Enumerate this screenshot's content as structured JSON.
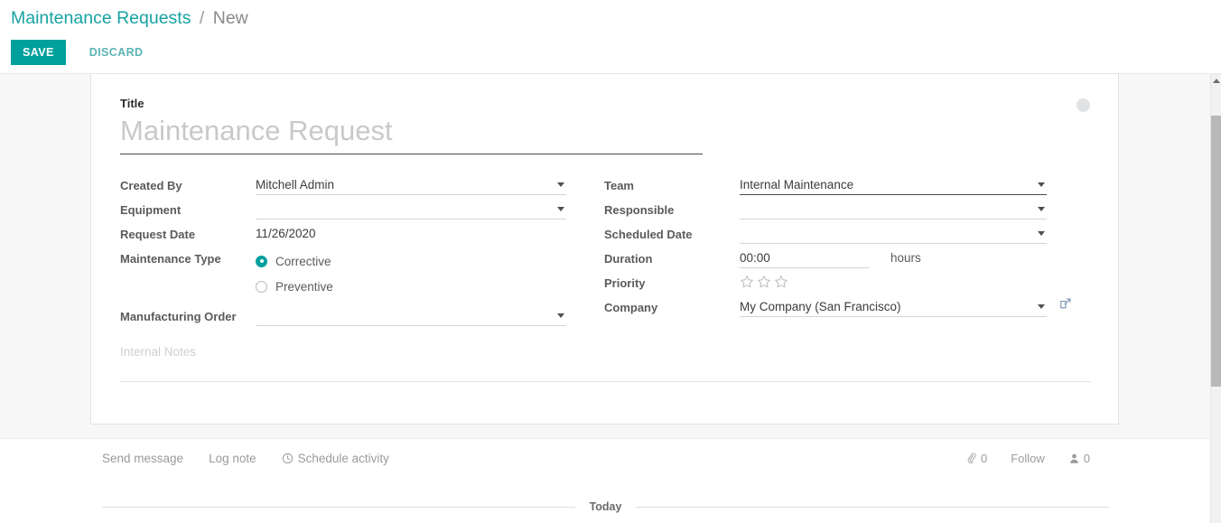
{
  "breadcrumb": {
    "root": "Maintenance Requests",
    "separator": "/",
    "current": "New"
  },
  "actions": {
    "save_label": "SAVE",
    "discard_label": "DISCARD",
    "save_color": "#00a09d",
    "discard_color": "#5bb4b4"
  },
  "form": {
    "title_label": "Title",
    "title_value": "",
    "title_placeholder": "Maintenance Request",
    "left_fields": [
      {
        "label": "Created By",
        "value": "Mitchell Admin",
        "type": "many2one"
      },
      {
        "label": "Equipment",
        "value": "",
        "type": "many2one"
      },
      {
        "label": "Request Date",
        "value": "11/26/2020",
        "type": "text"
      },
      {
        "label": "Maintenance Type",
        "value": "",
        "type": "radio"
      },
      {
        "label": "Manufacturing Order",
        "value": "",
        "type": "many2one"
      }
    ],
    "maintenance_type": {
      "options": [
        {
          "label": "Corrective",
          "selected": true
        },
        {
          "label": "Preventive",
          "selected": false
        }
      ],
      "selected_color": "#00a09d"
    },
    "right_fields": [
      {
        "label": "Team",
        "value": "Internal Maintenance",
        "type": "many2one",
        "focused": true
      },
      {
        "label": "Responsible",
        "value": "",
        "type": "many2one",
        "focused": false
      },
      {
        "label": "Scheduled Date",
        "value": "",
        "type": "many2one",
        "focused": false
      },
      {
        "label": "Duration",
        "value": "00:00",
        "type": "duration",
        "suffix": "hours"
      },
      {
        "label": "Priority",
        "value": "",
        "type": "stars",
        "stars_total": 3,
        "stars_filled": 0
      },
      {
        "label": "Company",
        "value": "My Company (San Francisco)",
        "type": "many2one",
        "focused": false,
        "external_link": true
      }
    ],
    "duration_suffix": "hours",
    "notes_placeholder": "Internal Notes",
    "notes_value": ""
  },
  "chatter": {
    "send_message": "Send message",
    "log_note": "Log note",
    "schedule_activity": "Schedule activity",
    "attachment_count": "0",
    "follow_label": "Follow",
    "follower_count": "0",
    "today_label": "Today"
  },
  "icons": {
    "avatar": "avatar-placeholder-circle",
    "dropdown": "chevron-down-icon",
    "clock": "clock-icon",
    "paperclip": "paperclip-icon",
    "user": "user-icon",
    "external": "external-link-icon",
    "star": "star-outline-icon"
  }
}
